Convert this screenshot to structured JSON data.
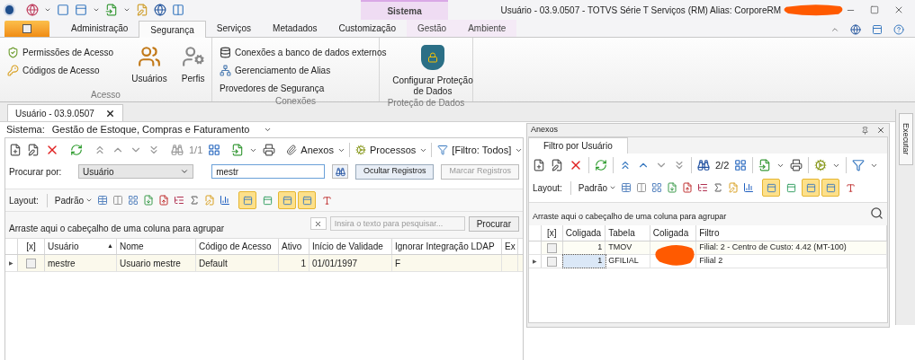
{
  "window": {
    "title": "Usuário - 03.9.0507 - TOTVS Série T Serviços (RM) Alias: CorporeRM"
  },
  "context_group": "Sistema",
  "ribbon_tabs": [
    {
      "label": "Administração",
      "selected": false,
      "context": false
    },
    {
      "label": "Segurança",
      "selected": true,
      "context": false
    },
    {
      "label": "Serviços",
      "selected": false,
      "context": false
    },
    {
      "label": "Metadados",
      "selected": false,
      "context": false
    },
    {
      "label": "Customização",
      "selected": false,
      "context": false
    },
    {
      "label": "Gestão",
      "selected": false,
      "context": true
    },
    {
      "label": "Ambiente",
      "selected": false,
      "context": true
    }
  ],
  "ribbon_groups": [
    {
      "title": "Acesso",
      "items": [
        {
          "label": "Permissões de Acesso",
          "kind": "small"
        },
        {
          "label": "Códigos de Acesso",
          "kind": "small"
        },
        {
          "label": "Usuários",
          "kind": "large"
        },
        {
          "label": "Perfis",
          "kind": "large"
        }
      ]
    },
    {
      "title": "Conexões",
      "items": [
        {
          "label": "Conexões a banco de dados externos",
          "kind": "small"
        },
        {
          "label": "Gerenciamento de Alias",
          "kind": "small"
        },
        {
          "label": "Provedores de Segurança",
          "kind": "small"
        }
      ]
    },
    {
      "title": "Proteção de Dados",
      "items": [
        {
          "label": "Configurar Proteção de Dados",
          "kind": "large"
        }
      ]
    }
  ],
  "document_tab": {
    "label": "Usuário - 03.9.0507"
  },
  "system": {
    "label": "Sistema:",
    "value": "Gestão de Estoque, Compras e Faturamento"
  },
  "main": {
    "counter": "1/1",
    "menus": [
      "Anexos",
      "Processos",
      "[Filtro: Todos]"
    ],
    "search": {
      "label": "Procurar por:",
      "field": "Usuário",
      "value": "mestr",
      "buttons": [
        {
          "label": "Ocultar Registros",
          "disabled": false
        },
        {
          "label": "Marcar Registros",
          "disabled": true
        }
      ]
    },
    "layout": {
      "label": "Layout:",
      "preset": "Padrão",
      "toggles": [
        {
          "selected": true
        },
        {
          "selected": false
        },
        {
          "selected": true
        },
        {
          "selected": true
        },
        {
          "selected": false
        }
      ]
    },
    "group_panel": "Arraste aqui o cabeçalho de uma coluna para agrupar",
    "grid_search": {
      "placeholder": "Insira o texto para pesquisar...",
      "button": "Procurar"
    },
    "table": {
      "current_marker": "▶",
      "columns": [
        {
          "label": "[x]",
          "kind": "check"
        },
        {
          "label": "Usuário",
          "kind": "text",
          "sort_mark": "▲"
        },
        {
          "label": "Nome",
          "kind": "text"
        },
        {
          "label": "Código de Acesso",
          "kind": "text"
        },
        {
          "label": "Ativo",
          "kind": "number"
        },
        {
          "label": "Início de Validade",
          "kind": "text"
        },
        {
          "label": "Ignorar Integração LDAP",
          "kind": "text"
        },
        {
          "label": "Ex",
          "kind": "text"
        }
      ],
      "rows": [
        {
          "current": true,
          "checked": false,
          "cells": [
            "",
            "mestre",
            "Usuario mestre",
            "Default",
            "1",
            "01/01/1997",
            "F",
            ""
          ]
        }
      ]
    }
  },
  "side_panel": {
    "title": "Anexos",
    "tab": "Filtro por Usuário",
    "counter": "2/2",
    "layout": {
      "label": "Layout:",
      "preset": "Padrão",
      "toggles": [
        {
          "selected": true
        },
        {
          "selected": false
        },
        {
          "selected": true
        },
        {
          "selected": true
        },
        {
          "selected": false
        }
      ]
    },
    "group_panel": "Arraste aqui o cabeçalho de uma coluna para agrupar",
    "table": {
      "current_marker": "▶",
      "columns": [
        {
          "label": "[x]",
          "kind": "check"
        },
        {
          "label": "Coligada",
          "kind": "number"
        },
        {
          "label": "Tabela",
          "kind": "text"
        },
        {
          "label": "Coligada",
          "kind": "text"
        },
        {
          "label": "Filtro",
          "kind": "text"
        }
      ],
      "rows": [
        {
          "current": false,
          "checked": false,
          "cells": [
            "",
            "1",
            "TMOV",
            "",
            "Filial: 2 - Centro de Custo: 4.42 (MT-100)"
          ]
        },
        {
          "current": true,
          "checked": false,
          "cells": [
            "",
            "1",
            "GFILIAL",
            "",
            "Filial 2"
          ]
        }
      ]
    }
  },
  "side_strip": {
    "label": "Executar"
  }
}
